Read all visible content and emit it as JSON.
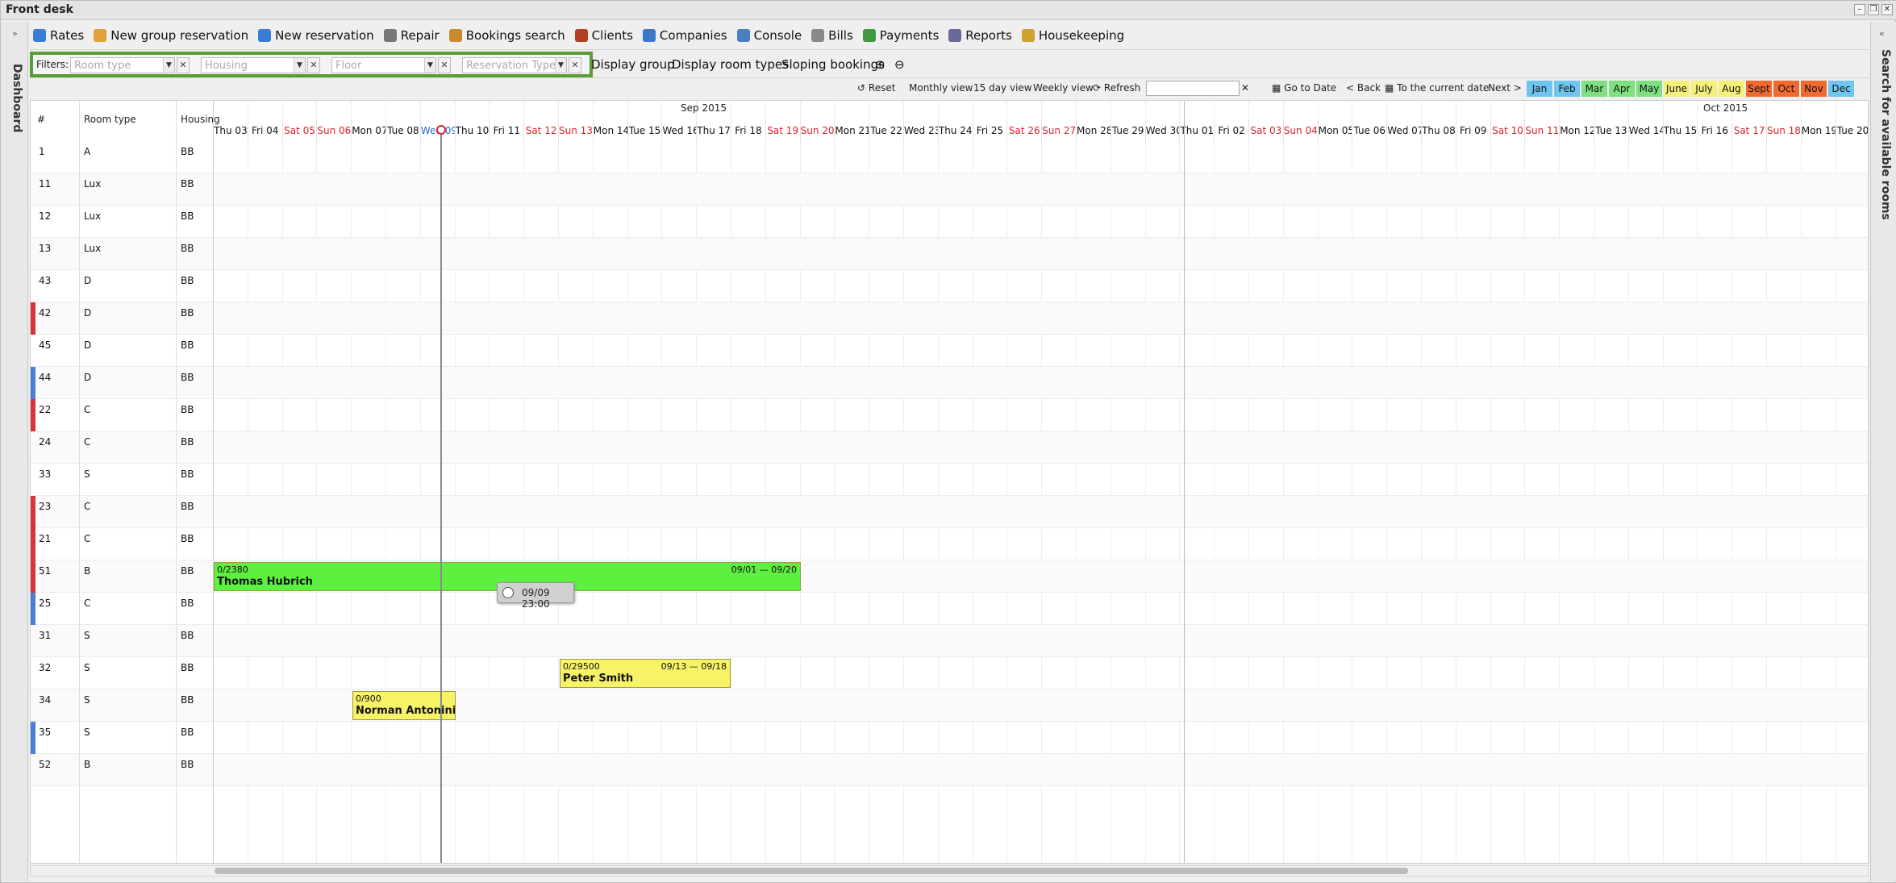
{
  "window": {
    "title": "Front desk"
  },
  "menu": [
    {
      "label": "Rates",
      "icon": "rates-icon",
      "color": "#3b7bd8"
    },
    {
      "label": "New group reservation",
      "icon": "group-reservation-icon",
      "color": "#e2a03a"
    },
    {
      "label": "New reservation",
      "icon": "new-reservation-icon",
      "color": "#3a7bd5"
    },
    {
      "label": "Repair",
      "icon": "repair-icon",
      "color": "#777777"
    },
    {
      "label": "Bookings search",
      "icon": "search-icon",
      "color": "#c98a2e"
    },
    {
      "label": "Clients",
      "icon": "clients-icon",
      "color": "#b04020"
    },
    {
      "label": "Companies",
      "icon": "companies-icon",
      "color": "#3a78c8"
    },
    {
      "label": "Console",
      "icon": "console-icon",
      "color": "#4a80c0"
    },
    {
      "label": "Bills",
      "icon": "bills-icon",
      "color": "#8a8a8a"
    },
    {
      "label": "Payments",
      "icon": "payments-icon",
      "color": "#3f9a3f"
    },
    {
      "label": "Reports",
      "icon": "reports-icon",
      "color": "#6a6a9a"
    },
    {
      "label": "Housekeeping",
      "icon": "housekeeping-icon",
      "color": "#d0a030"
    }
  ],
  "filters": {
    "label": "Filters:",
    "room_type": "Room type",
    "housing": "Housing",
    "floor": "Floor",
    "reservation_type": "Reservation Type"
  },
  "filter_buttons": {
    "display_group": "Display group",
    "display_room_types": "Display room types",
    "sloping_bookings": "Sloping bookings"
  },
  "nav": {
    "reset": "Reset",
    "monthly": "Monthly view",
    "fifteen": "15 day view",
    "weekly": "Weekly view",
    "refresh": "Refresh",
    "goto": "Go to Date",
    "back": "< Back",
    "current": "To the current date",
    "next": "Next >"
  },
  "months": [
    {
      "label": "Jan",
      "color": "#6ec6f0"
    },
    {
      "label": "Feb",
      "color": "#6ec6f0"
    },
    {
      "label": "Mar",
      "color": "#7ee07e"
    },
    {
      "label": "Apr",
      "color": "#7ee07e"
    },
    {
      "label": "May",
      "color": "#7ee07e"
    },
    {
      "label": "June",
      "color": "#f5f07a"
    },
    {
      "label": "July",
      "color": "#f5f07a"
    },
    {
      "label": "Aug",
      "color": "#f5f07a"
    },
    {
      "label": "Sept",
      "color": "#ef6a2e"
    },
    {
      "label": "Oct",
      "color": "#ef6a2e"
    },
    {
      "label": "Nov",
      "color": "#ef6a2e"
    },
    {
      "label": "Dec",
      "color": "#6ec6f0"
    }
  ],
  "grid": {
    "col_num": "#",
    "col_type": "Room type",
    "col_housing": "Housing",
    "month_sep": "Sep 2015",
    "month_oct": "Oct 2015",
    "days": [
      "Thu 03",
      "Fri 04",
      "Sat 05",
      "Sun 06",
      "Mon 07",
      "Tue 08",
      "Wed 09",
      "Thu 10",
      "Fri 11",
      "Sat 12",
      "Sun 13",
      "Mon 14",
      "Tue 15",
      "Wed 16",
      "Thu 17",
      "Fri 18",
      "Sat 19",
      "Sun 20",
      "Mon 21",
      "Tue 22",
      "Wed 23",
      "Thu 24",
      "Fri 25",
      "Sat 26",
      "Sun 27",
      "Mon 28",
      "Tue 29",
      "Wed 30",
      "Thu 01",
      "Fri 02",
      "Sat 03",
      "Sun 04",
      "Mon 05",
      "Tue 06",
      "Wed 07",
      "Thu 08",
      "Fri 09",
      "Sat 10",
      "Sun 11",
      "Mon 12",
      "Tue 13",
      "Wed 14",
      "Thu 15",
      "Fri 16",
      "Sat 17",
      "Sun 18",
      "Mon 19",
      "Tue 20"
    ]
  },
  "rooms": [
    {
      "num": "1",
      "type": "A",
      "housing": "BB",
      "mark": ""
    },
    {
      "num": "11",
      "type": "Lux",
      "housing": "BB",
      "mark": ""
    },
    {
      "num": "12",
      "type": "Lux",
      "housing": "BB",
      "mark": ""
    },
    {
      "num": "13",
      "type": "Lux",
      "housing": "BB",
      "mark": ""
    },
    {
      "num": "43",
      "type": "D",
      "housing": "BB",
      "mark": ""
    },
    {
      "num": "42",
      "type": "D",
      "housing": "BB",
      "mark": "#d8343a"
    },
    {
      "num": "45",
      "type": "D",
      "housing": "BB",
      "mark": ""
    },
    {
      "num": "44",
      "type": "D",
      "housing": "BB",
      "mark": "#4a7fd8"
    },
    {
      "num": "22",
      "type": "C",
      "housing": "BB",
      "mark": "#d8343a"
    },
    {
      "num": "24",
      "type": "C",
      "housing": "BB",
      "mark": ""
    },
    {
      "num": "33",
      "type": "S",
      "housing": "BB",
      "mark": ""
    },
    {
      "num": "23",
      "type": "C",
      "housing": "BB",
      "mark": "#d8343a"
    },
    {
      "num": "21",
      "type": "C",
      "housing": "BB",
      "mark": "#d8343a"
    },
    {
      "num": "51",
      "type": "B",
      "housing": "BB",
      "mark": "#d8343a"
    },
    {
      "num": "25",
      "type": "C",
      "housing": "BB",
      "mark": "#4a7fd8"
    },
    {
      "num": "31",
      "type": "S",
      "housing": "BB",
      "mark": ""
    },
    {
      "num": "32",
      "type": "S",
      "housing": "BB",
      "mark": ""
    },
    {
      "num": "34",
      "type": "S",
      "housing": "BB",
      "mark": ""
    },
    {
      "num": "35",
      "type": "S",
      "housing": "BB",
      "mark": "#4a7fd8"
    },
    {
      "num": "52",
      "type": "B",
      "housing": "BB",
      "mark": ""
    }
  ],
  "bookings": [
    {
      "code": "0/2380",
      "name": "Thomas Hubrich",
      "dates": "09/01 — 09/20",
      "color": "#5df040"
    },
    {
      "code": "0/29500",
      "name": "Peter Smith",
      "dates": "09/13 — 09/18",
      "color": "#f7f266"
    },
    {
      "code": "0/900",
      "name": "Norman Antonini",
      "dates": "",
      "color": "#f7f266"
    }
  ],
  "tooltip": {
    "text": "09/09 23:00"
  },
  "side": {
    "left": "Dashboard",
    "right": "Search for available rooms"
  }
}
